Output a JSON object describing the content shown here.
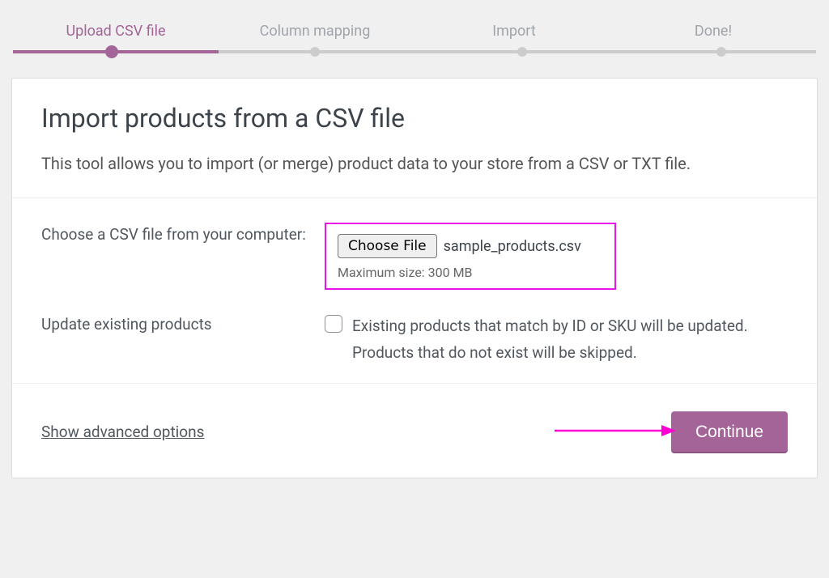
{
  "stepper": {
    "steps": [
      "Upload CSV file",
      "Column mapping",
      "Import",
      "Done!"
    ],
    "activeIndex": 0
  },
  "header": {
    "title": "Import products from a CSV file",
    "subtitle": "This tool allows you to import (or merge) product data to your store from a CSV or TXT file."
  },
  "form": {
    "fileRow": {
      "label": "Choose a CSV file from your computer:",
      "buttonLabel": "Choose File",
      "selectedFile": "sample_products.csv",
      "hint": "Maximum size: 300 MB"
    },
    "updateRow": {
      "label": "Update existing products",
      "checked": false,
      "description": "Existing products that match by ID or SKU will be updated. Products that do not exist will be skipped."
    }
  },
  "footer": {
    "advancedLink": "Show advanced options",
    "continueLabel": "Continue"
  },
  "colors": {
    "accent": "#a46497",
    "highlight": "#e815e8"
  }
}
